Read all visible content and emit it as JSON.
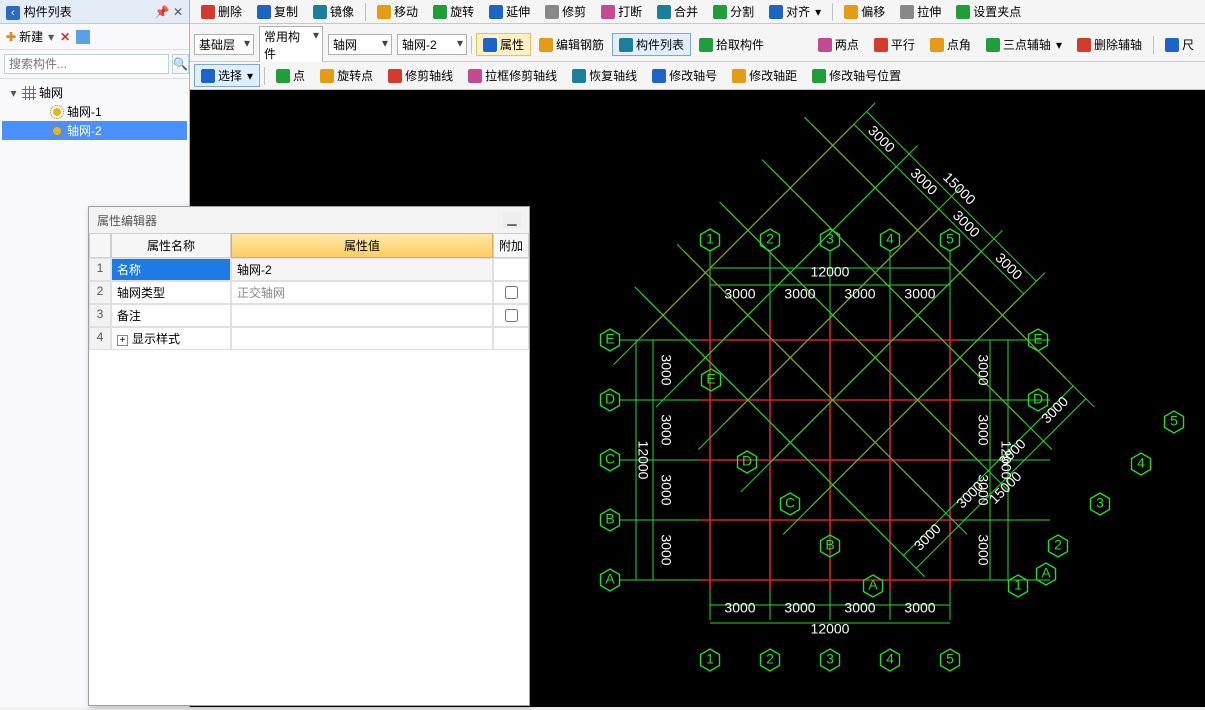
{
  "toolbar1": {
    "delete": "删除",
    "copy": "复制",
    "mirror": "镜像",
    "move": "移动",
    "rotate": "旋转",
    "extend": "延伸",
    "trim": "修剪",
    "break": "打断",
    "merge": "合并",
    "split": "分割",
    "align": "对齐",
    "offset": "偏移",
    "stretch": "拉伸",
    "setgrip": "设置夹点"
  },
  "toolbar2": {
    "layer": "基础层",
    "category": "常用构件",
    "type": "轴网",
    "instance": "轴网-2",
    "props": "属性",
    "editrebar": "编辑钢筋",
    "componentlist": "构件列表",
    "pick": "拾取构件",
    "twoPoint": "两点",
    "parallel": "平行",
    "pointAngle": "点角",
    "threePointAux": "三点辅轴",
    "deleteAux": "删除辅轴",
    "ruler": "尺"
  },
  "toolbar3": {
    "select": "选择",
    "point": "点",
    "rotpoint": "旋转点",
    "trimaxis": "修剪轴线",
    "boxtrimaxis": "拉框修剪轴线",
    "restoreaxis": "恢复轴线",
    "modifyaxisnum": "修改轴号",
    "modifyaxisdist": "修改轴距",
    "modifyaxisnumpos": "修改轴号位置"
  },
  "leftPanel": {
    "title": "构件列表",
    "new": "新建",
    "searchPlaceholder": "搜索构件...",
    "rootNode": "轴网",
    "items": [
      "轴网-1",
      "轴网-2"
    ],
    "selectedIndex": 1
  },
  "propDlg": {
    "title": "属性编辑器",
    "headers": {
      "name": "属性名称",
      "value": "属性值",
      "extra": "附加"
    },
    "rows": [
      {
        "idx": "1",
        "name": "名称",
        "value": "轴网-2",
        "chk": false,
        "selected": true
      },
      {
        "idx": "2",
        "name": "轴网类型",
        "value": "正交轴网",
        "chk": false
      },
      {
        "idx": "3",
        "name": "备注",
        "value": "",
        "chk": false
      },
      {
        "idx": "4",
        "name": "显示样式",
        "value": "",
        "expandable": true
      }
    ]
  },
  "grid": {
    "colLabels": [
      "1",
      "2",
      "3",
      "4",
      "5"
    ],
    "rowLabels": [
      "A",
      "B",
      "C",
      "D",
      "E"
    ],
    "spacing": "3000",
    "total": "12000",
    "diagTotal": "15000"
  }
}
